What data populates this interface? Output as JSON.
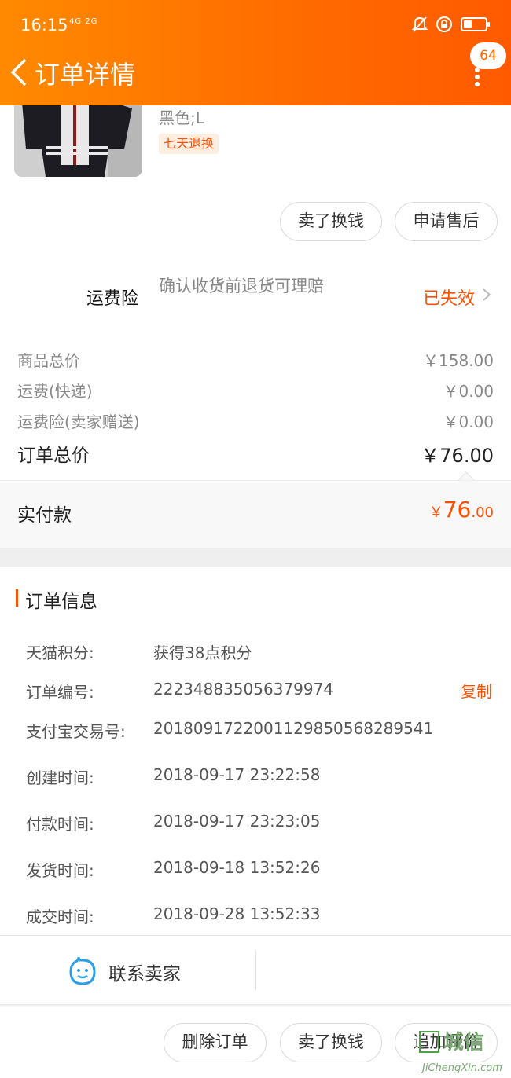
{
  "status_bar": {
    "time": "16:15",
    "network": "4G 2G",
    "battery_level": 0.3
  },
  "nav": {
    "title": "订单详情",
    "badge_count": "64"
  },
  "product": {
    "sku": "黑色;L",
    "tag": "七天退换"
  },
  "item_actions": {
    "sell": "卖了换钱",
    "after_sale": "申请售后"
  },
  "insurance": {
    "label": "运费险",
    "desc": "确认收货前退货可理赔",
    "status": "已失效"
  },
  "prices": [
    {
      "label": "商品总价",
      "value": "￥158.00"
    },
    {
      "label": "运费(快递)",
      "value": "￥0.00"
    },
    {
      "label": "运费险(卖家赠送)",
      "value": "￥0.00"
    }
  ],
  "order_total": {
    "label": "订单总价",
    "value": "￥76.00"
  },
  "paid": {
    "label": "实付款",
    "currency": "￥",
    "integer": "76",
    "decimal": ".00"
  },
  "order_info": {
    "title": "订单信息",
    "rows": [
      {
        "label": "天猫积分:",
        "value": "获得38点积分"
      },
      {
        "label": "订单编号:",
        "value": "2223488350563799​74"
      },
      {
        "label": "支付宝交易号:",
        "value": "2018091722001129850568289541"
      },
      {
        "label": "创建时间:",
        "value": "2018-09-17 23:22:58"
      },
      {
        "label": "付款时间:",
        "value": "2018-09-17 23:23:05"
      },
      {
        "label": "发货时间:",
        "value": "2018-09-18 13:52:26"
      },
      {
        "label": "成交时间:",
        "value": "2018-09-28 13:52:33"
      }
    ],
    "copy_label": "复制"
  },
  "contact": {
    "label": "联系卖家"
  },
  "bottom_actions": {
    "delete": "删除订单",
    "sell": "卖了换钱",
    "review": "追加评价"
  },
  "watermark": {
    "text": "城信",
    "sub": "JiChengXin.com"
  },
  "colors": {
    "brand": "#ff6a00",
    "accent": "#ff5000"
  }
}
